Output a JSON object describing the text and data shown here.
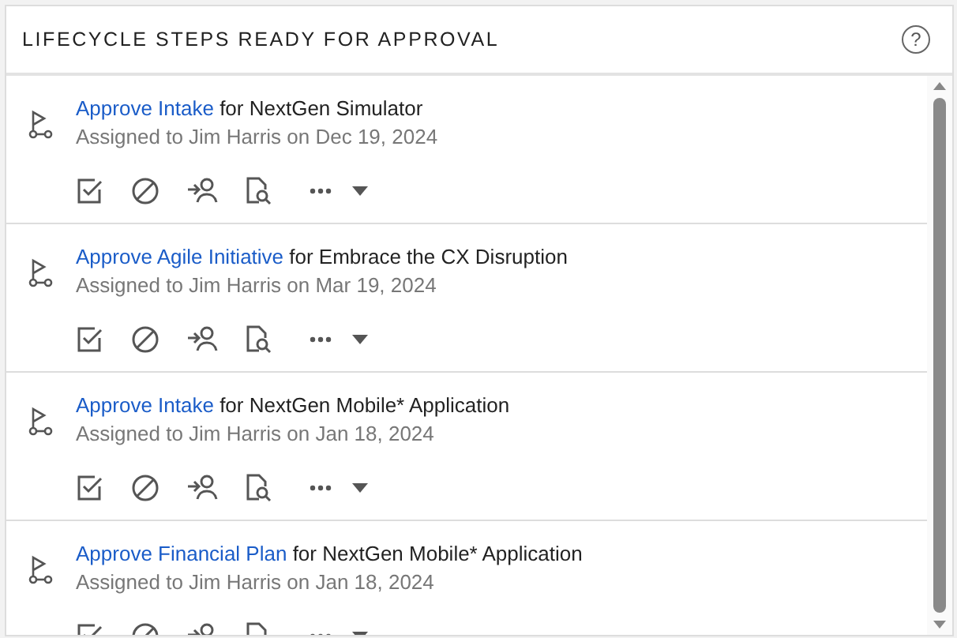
{
  "header": {
    "title": "LIFECYCLE STEPS READY FOR APPROVAL",
    "help_icon": "?"
  },
  "steps": [
    {
      "action": "Approve Intake",
      "target": "for NextGen Simulator",
      "assigned": "Assigned to Jim Harris on Dec 19, 2024"
    },
    {
      "action": "Approve Agile Initiative",
      "target": "for Embrace the CX Disruption",
      "assigned": "Assigned to Jim Harris on Mar 19, 2024"
    },
    {
      "action": "Approve Intake",
      "target": "for NextGen Mobile* Application",
      "assigned": "Assigned to Jim Harris on Jan 18, 2024"
    },
    {
      "action": "Approve Financial Plan",
      "target": "for NextGen Mobile* Application",
      "assigned": "Assigned to Jim Harris on Jan 18, 2024"
    }
  ]
}
